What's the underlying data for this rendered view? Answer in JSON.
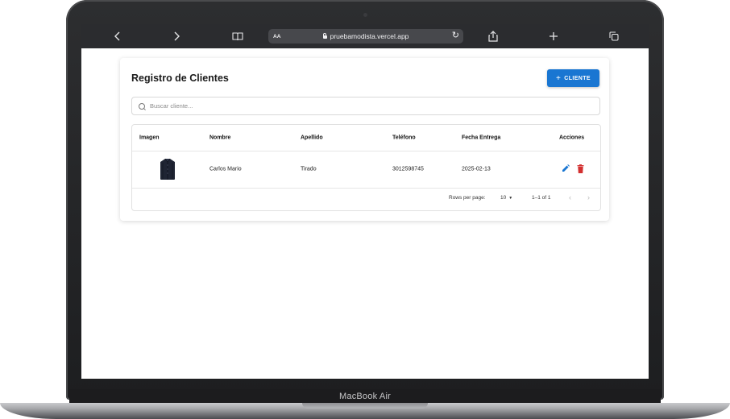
{
  "device": {
    "label": "MacBook Air"
  },
  "browser": {
    "text_size_label": "AA",
    "url": "pruebamodista.vercel.app",
    "icons": [
      "chevron-left-icon",
      "chevron-right-icon",
      "book-icon",
      "lock-icon",
      "reload-icon",
      "share-icon",
      "plus-icon",
      "tabs-icon"
    ]
  },
  "page": {
    "title": "Registro de Clientes",
    "add_button": "CLIENTE",
    "search_placeholder": "Buscar cliente...",
    "accent_color": "#1976d2",
    "delete_color": "#d32f2f"
  },
  "table": {
    "headers": [
      "Imagen",
      "Nombre",
      "Apellido",
      "Teléfono",
      "Fecha Entrega",
      "Acciones"
    ],
    "rows": [
      {
        "image": "shirt-image",
        "nombre": "Carlos Mario",
        "apellido": "Tirado",
        "telefono": "3012598745",
        "fecha_entrega": "2025-02-13"
      }
    ],
    "pagination": {
      "rows_per_page_label": "Rows per page:",
      "rows_per_page_value": "10",
      "range": "1–1 of 1"
    }
  }
}
